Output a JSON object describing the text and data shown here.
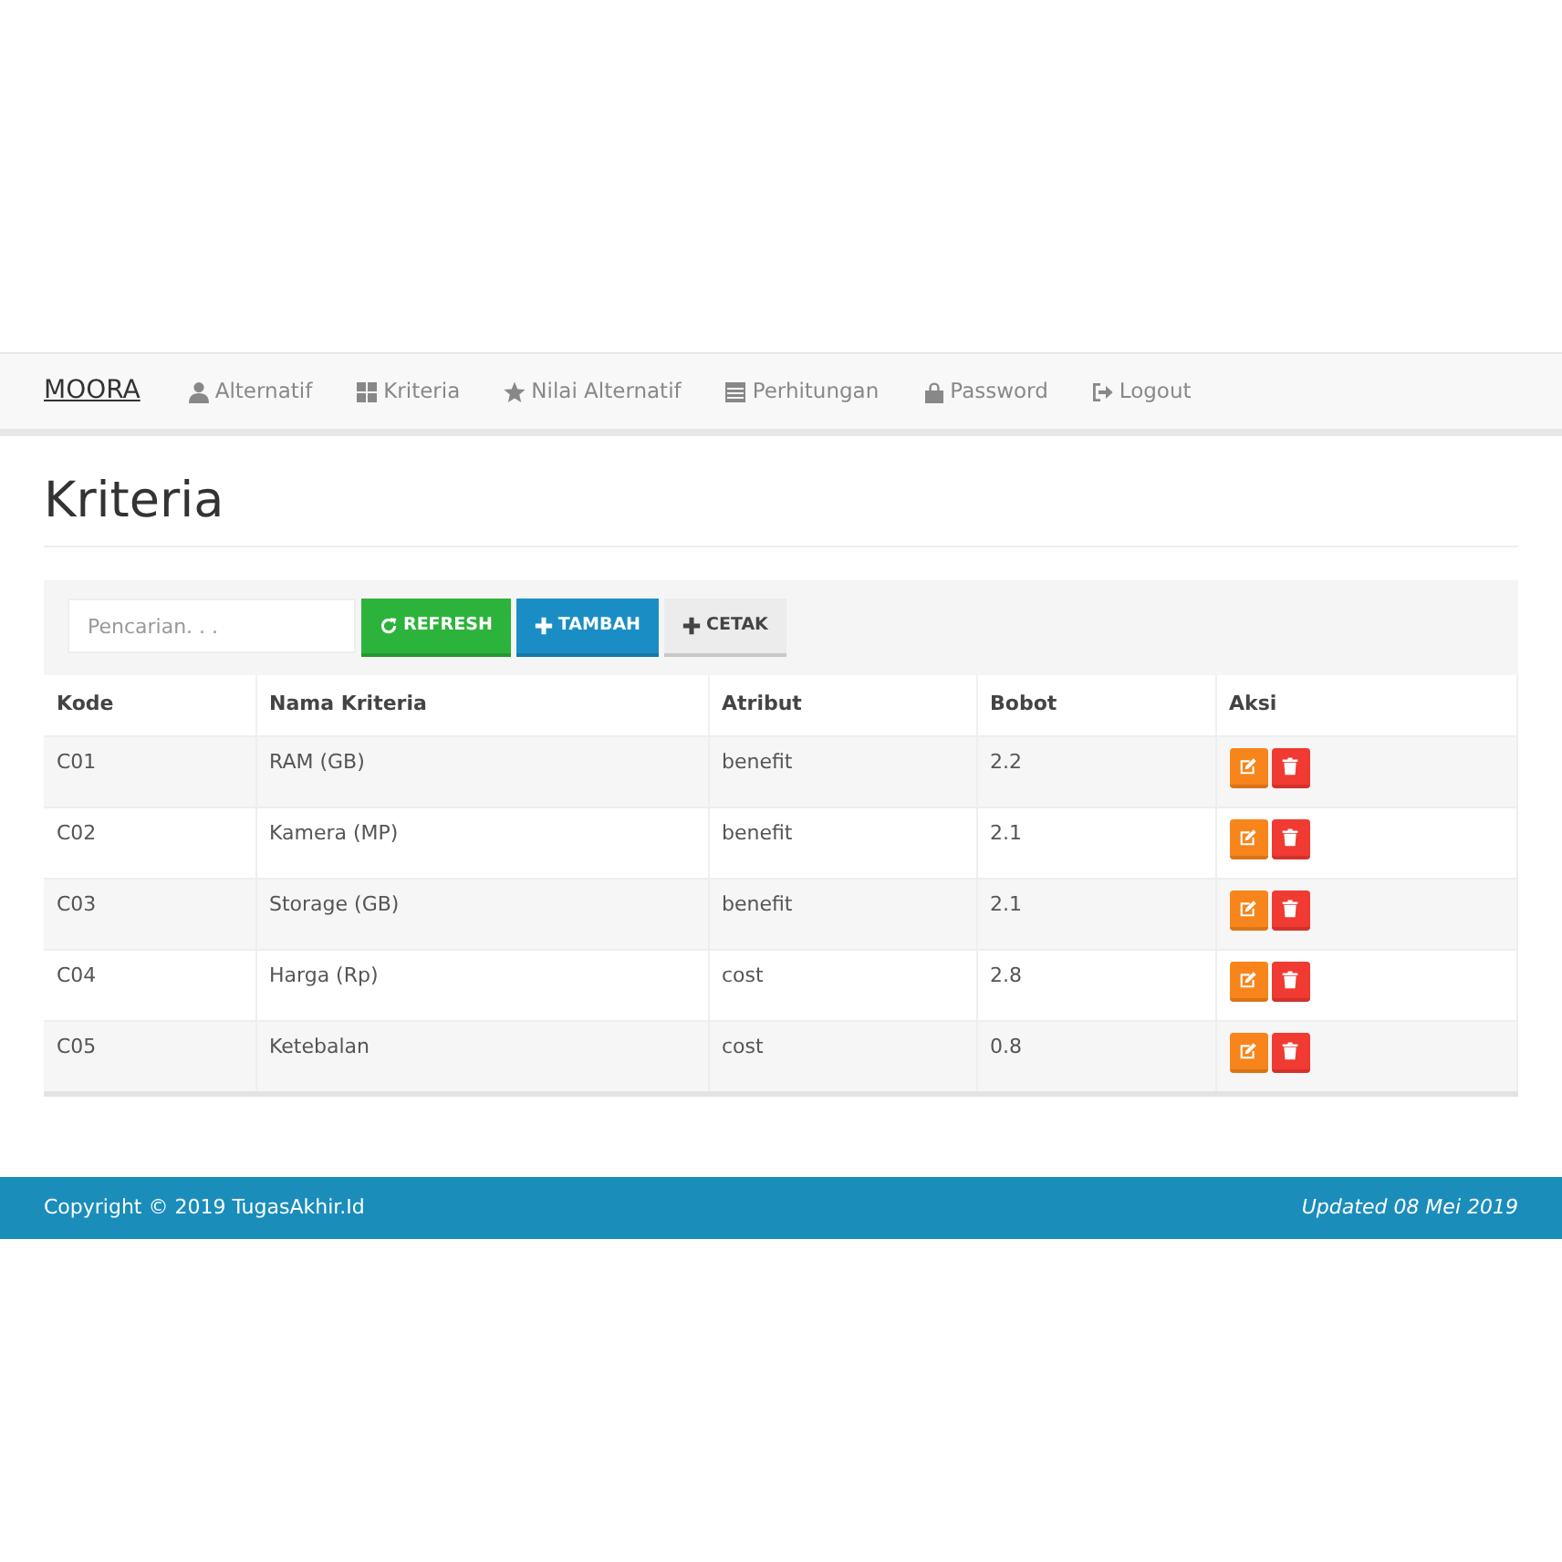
{
  "navbar": {
    "brand": "MOORA",
    "items": [
      {
        "label": "Alternatif",
        "selected": false
      },
      {
        "label": "Kriteria",
        "selected": false
      },
      {
        "label": "Nilai Alternatif",
        "selected": false
      },
      {
        "label": "Perhitungan",
        "selected": false
      },
      {
        "label": "Password",
        "selected": false
      },
      {
        "label": "Logout",
        "selected": false
      }
    ]
  },
  "page_title": "Kriteria",
  "toolbar": {
    "search": {
      "placeholder": "Pencarian. . ."
    },
    "buttons": [
      "REFRESH",
      "TAMBAH",
      "CETAK"
    ]
  },
  "table": {
    "columns": [
      "Kode",
      "Nama Kriteria",
      "Atribut",
      "Bobot",
      "Aksi"
    ],
    "rows": [
      [
        "C01",
        "RAM (GB)",
        "benefit",
        "2.2"
      ],
      [
        "C02",
        "Kamera (MP)",
        "benefit",
        "2.1"
      ],
      [
        "C03",
        "Storage (GB)",
        "benefit",
        "2.1"
      ],
      [
        "C04",
        "Harga (Rp)",
        "cost",
        "2.8"
      ],
      [
        "C05",
        "Ketebalan",
        "cost",
        "0.8"
      ]
    ]
  },
  "footer": {
    "copyright": "Copyright © 2019 TugasAkhir.Id",
    "updated": "Updated 08 Mei 2019"
  }
}
